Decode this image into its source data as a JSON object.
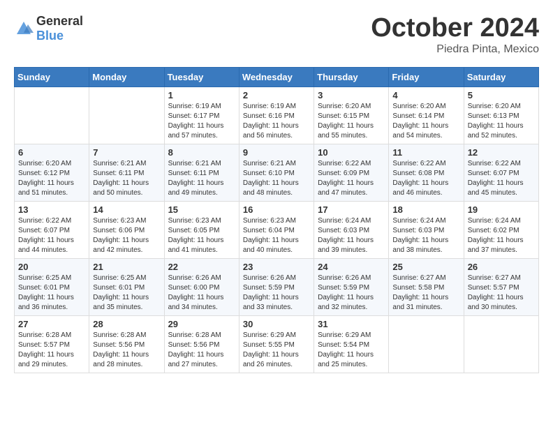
{
  "header": {
    "logo_general": "General",
    "logo_blue": "Blue",
    "month": "October 2024",
    "location": "Piedra Pinta, Mexico"
  },
  "weekdays": [
    "Sunday",
    "Monday",
    "Tuesday",
    "Wednesday",
    "Thursday",
    "Friday",
    "Saturday"
  ],
  "weeks": [
    [
      {
        "day": "",
        "text": ""
      },
      {
        "day": "",
        "text": ""
      },
      {
        "day": "1",
        "text": "Sunrise: 6:19 AM\nSunset: 6:17 PM\nDaylight: 11 hours and 57 minutes."
      },
      {
        "day": "2",
        "text": "Sunrise: 6:19 AM\nSunset: 6:16 PM\nDaylight: 11 hours and 56 minutes."
      },
      {
        "day": "3",
        "text": "Sunrise: 6:20 AM\nSunset: 6:15 PM\nDaylight: 11 hours and 55 minutes."
      },
      {
        "day": "4",
        "text": "Sunrise: 6:20 AM\nSunset: 6:14 PM\nDaylight: 11 hours and 54 minutes."
      },
      {
        "day": "5",
        "text": "Sunrise: 6:20 AM\nSunset: 6:13 PM\nDaylight: 11 hours and 52 minutes."
      }
    ],
    [
      {
        "day": "6",
        "text": "Sunrise: 6:20 AM\nSunset: 6:12 PM\nDaylight: 11 hours and 51 minutes."
      },
      {
        "day": "7",
        "text": "Sunrise: 6:21 AM\nSunset: 6:11 PM\nDaylight: 11 hours and 50 minutes."
      },
      {
        "day": "8",
        "text": "Sunrise: 6:21 AM\nSunset: 6:11 PM\nDaylight: 11 hours and 49 minutes."
      },
      {
        "day": "9",
        "text": "Sunrise: 6:21 AM\nSunset: 6:10 PM\nDaylight: 11 hours and 48 minutes."
      },
      {
        "day": "10",
        "text": "Sunrise: 6:22 AM\nSunset: 6:09 PM\nDaylight: 11 hours and 47 minutes."
      },
      {
        "day": "11",
        "text": "Sunrise: 6:22 AM\nSunset: 6:08 PM\nDaylight: 11 hours and 46 minutes."
      },
      {
        "day": "12",
        "text": "Sunrise: 6:22 AM\nSunset: 6:07 PM\nDaylight: 11 hours and 45 minutes."
      }
    ],
    [
      {
        "day": "13",
        "text": "Sunrise: 6:22 AM\nSunset: 6:07 PM\nDaylight: 11 hours and 44 minutes."
      },
      {
        "day": "14",
        "text": "Sunrise: 6:23 AM\nSunset: 6:06 PM\nDaylight: 11 hours and 42 minutes."
      },
      {
        "day": "15",
        "text": "Sunrise: 6:23 AM\nSunset: 6:05 PM\nDaylight: 11 hours and 41 minutes."
      },
      {
        "day": "16",
        "text": "Sunrise: 6:23 AM\nSunset: 6:04 PM\nDaylight: 11 hours and 40 minutes."
      },
      {
        "day": "17",
        "text": "Sunrise: 6:24 AM\nSunset: 6:03 PM\nDaylight: 11 hours and 39 minutes."
      },
      {
        "day": "18",
        "text": "Sunrise: 6:24 AM\nSunset: 6:03 PM\nDaylight: 11 hours and 38 minutes."
      },
      {
        "day": "19",
        "text": "Sunrise: 6:24 AM\nSunset: 6:02 PM\nDaylight: 11 hours and 37 minutes."
      }
    ],
    [
      {
        "day": "20",
        "text": "Sunrise: 6:25 AM\nSunset: 6:01 PM\nDaylight: 11 hours and 36 minutes."
      },
      {
        "day": "21",
        "text": "Sunrise: 6:25 AM\nSunset: 6:01 PM\nDaylight: 11 hours and 35 minutes."
      },
      {
        "day": "22",
        "text": "Sunrise: 6:26 AM\nSunset: 6:00 PM\nDaylight: 11 hours and 34 minutes."
      },
      {
        "day": "23",
        "text": "Sunrise: 6:26 AM\nSunset: 5:59 PM\nDaylight: 11 hours and 33 minutes."
      },
      {
        "day": "24",
        "text": "Sunrise: 6:26 AM\nSunset: 5:59 PM\nDaylight: 11 hours and 32 minutes."
      },
      {
        "day": "25",
        "text": "Sunrise: 6:27 AM\nSunset: 5:58 PM\nDaylight: 11 hours and 31 minutes."
      },
      {
        "day": "26",
        "text": "Sunrise: 6:27 AM\nSunset: 5:57 PM\nDaylight: 11 hours and 30 minutes."
      }
    ],
    [
      {
        "day": "27",
        "text": "Sunrise: 6:28 AM\nSunset: 5:57 PM\nDaylight: 11 hours and 29 minutes."
      },
      {
        "day": "28",
        "text": "Sunrise: 6:28 AM\nSunset: 5:56 PM\nDaylight: 11 hours and 28 minutes."
      },
      {
        "day": "29",
        "text": "Sunrise: 6:28 AM\nSunset: 5:56 PM\nDaylight: 11 hours and 27 minutes."
      },
      {
        "day": "30",
        "text": "Sunrise: 6:29 AM\nSunset: 5:55 PM\nDaylight: 11 hours and 26 minutes."
      },
      {
        "day": "31",
        "text": "Sunrise: 6:29 AM\nSunset: 5:54 PM\nDaylight: 11 hours and 25 minutes."
      },
      {
        "day": "",
        "text": ""
      },
      {
        "day": "",
        "text": ""
      }
    ]
  ]
}
